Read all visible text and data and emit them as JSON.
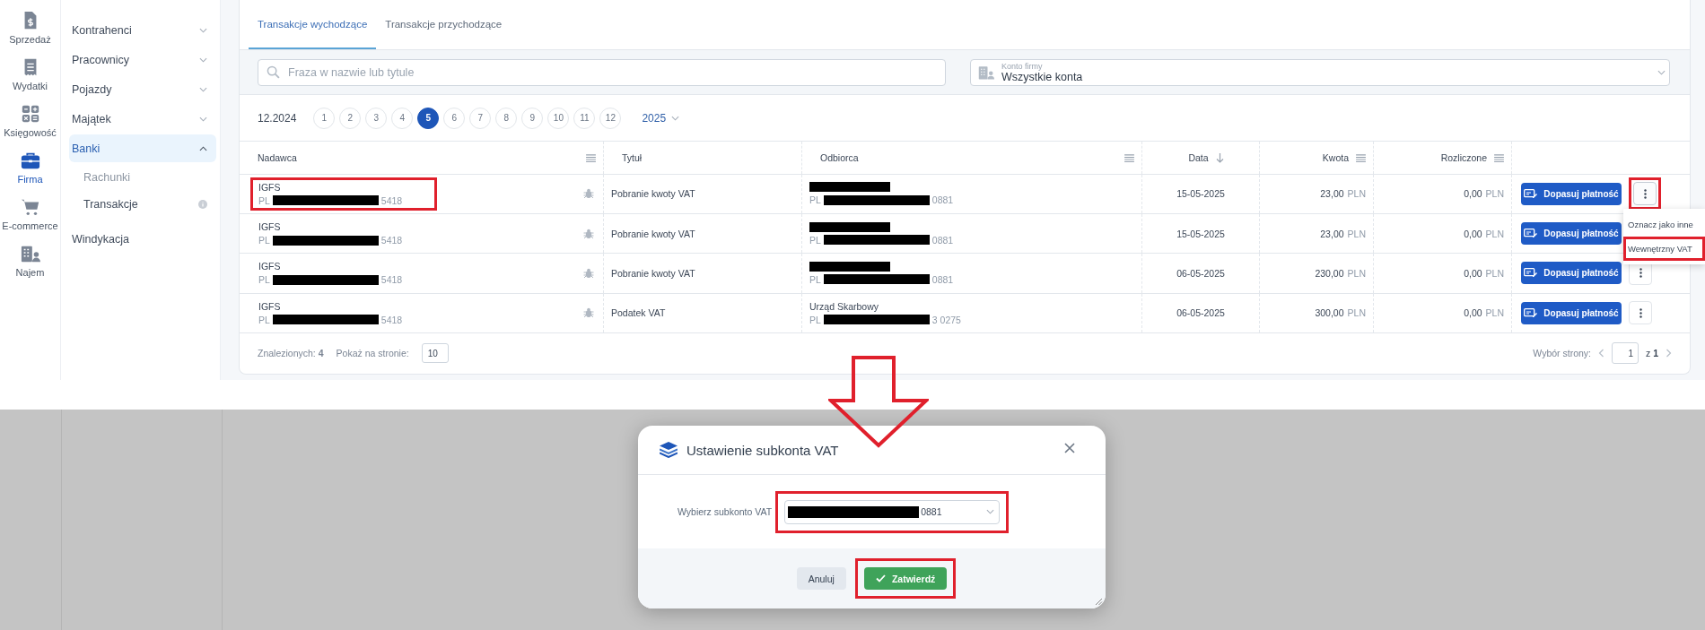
{
  "rail": [
    {
      "label": "Sprzedaż",
      "selected": false
    },
    {
      "label": "Wydatki",
      "selected": false
    },
    {
      "label": "Księgowość",
      "selected": false
    },
    {
      "label": "Firma",
      "selected": true
    },
    {
      "label": "E-commerce",
      "selected": false
    },
    {
      "label": "Najem",
      "selected": false
    }
  ],
  "nav": [
    {
      "label": "Kontrahenci",
      "expandable": true,
      "expanded": false,
      "selected": false
    },
    {
      "label": "Pracownicy",
      "expandable": true,
      "expanded": false,
      "selected": false
    },
    {
      "label": "Pojazdy",
      "expandable": true,
      "expanded": false,
      "selected": false
    },
    {
      "label": "Majątek",
      "expandable": true,
      "expanded": false,
      "selected": false
    },
    {
      "label": "Banki",
      "expandable": true,
      "expanded": true,
      "selected": true,
      "children": [
        {
          "label": "Rachunki",
          "muted": true,
          "info": false
        },
        {
          "label": "Transakcje",
          "muted": false,
          "info": true
        }
      ]
    },
    {
      "label": "Windykacja",
      "expandable": false,
      "selected": false
    }
  ],
  "tabs": [
    {
      "label": "Transakcje wychodzące",
      "selected": true
    },
    {
      "label": "Transakcje przychodzące",
      "selected": false
    }
  ],
  "search": {
    "placeholder": "Fraza w nazwie lub tytule"
  },
  "account_filter": {
    "label": "Konto firmy",
    "value": "Wszystkie konta"
  },
  "months": {
    "previous": "12.2024",
    "items": [
      {
        "label": "1",
        "selected": false
      },
      {
        "label": "2",
        "selected": false
      },
      {
        "label": "3",
        "selected": false
      },
      {
        "label": "4",
        "selected": false
      },
      {
        "label": "5",
        "selected": true
      },
      {
        "label": "6",
        "selected": false
      },
      {
        "label": "7",
        "selected": false
      },
      {
        "label": "8",
        "selected": false
      },
      {
        "label": "9",
        "selected": false
      },
      {
        "label": "10",
        "selected": false
      },
      {
        "label": "11",
        "selected": false
      },
      {
        "label": "12",
        "selected": false
      }
    ],
    "year": "2025"
  },
  "table": {
    "columns": [
      {
        "label": "Nadawca",
        "menu": true,
        "sorted": false
      },
      {
        "label": "Tytuł",
        "menu": false,
        "sorted": false
      },
      {
        "label": "Odbiorca",
        "menu": true,
        "sorted": false
      },
      {
        "label": "Data",
        "menu": false,
        "sorted": true
      },
      {
        "label": "Kwota",
        "menu": true,
        "sorted": false
      },
      {
        "label": "Rozliczone",
        "menu": true,
        "sorted": false
      }
    ],
    "rows": [
      {
        "sender": {
          "name": "IGFS",
          "prefix": "PL",
          "suffix": "5418",
          "redacted": true,
          "highlighted": true
        },
        "title": "Pobranie kwoty VAT",
        "recipient": {
          "name_redacted": true,
          "prefix": "PL",
          "suffix": "0881",
          "redacted": true
        },
        "date": "15-05-2025",
        "amount": "23,00",
        "amount_currency": "PLN",
        "settled": "0,00",
        "settled_currency": "PLN",
        "action": "Dopasuj płatność",
        "more_highlighted": true,
        "menu": {
          "items": [
            {
              "label": "Oznacz jako inne",
              "highlighted": false
            },
            {
              "label": "Wewnętrzny VAT",
              "highlighted": true
            }
          ]
        }
      },
      {
        "sender": {
          "name": "IGFS",
          "prefix": "PL",
          "suffix": "5418",
          "redacted": true,
          "highlighted": false
        },
        "title": "Pobranie kwoty VAT",
        "recipient": {
          "name_redacted": true,
          "prefix": "PL",
          "suffix": "0881",
          "redacted": true
        },
        "date": "15-05-2025",
        "amount": "23,00",
        "amount_currency": "PLN",
        "settled": "0,00",
        "settled_currency": "PLN",
        "action": "Dopasuj płatność"
      },
      {
        "sender": {
          "name": "IGFS",
          "prefix": "PL",
          "suffix": "5418",
          "redacted": true,
          "highlighted": false
        },
        "title": "Pobranie kwoty VAT",
        "recipient": {
          "name_redacted": true,
          "prefix": "PL",
          "suffix": "0881",
          "redacted": true
        },
        "date": "06-05-2025",
        "amount": "230,00",
        "amount_currency": "PLN",
        "settled": "0,00",
        "settled_currency": "PLN",
        "action": "Dopasuj płatność",
        "more_highlighted": false
      },
      {
        "sender": {
          "name": "IGFS",
          "prefix": "PL",
          "suffix": "5418",
          "redacted": true,
          "highlighted": false
        },
        "title": "Podatek VAT",
        "recipient": {
          "name": "Urząd Skarbowy",
          "prefix": "PL",
          "suffix": "3 0275",
          "redacted": true
        },
        "date": "06-05-2025",
        "amount": "300,00",
        "amount_currency": "PLN",
        "settled": "0,00",
        "settled_currency": "PLN",
        "action": "Dopasuj płatność",
        "more_highlighted": false
      }
    ]
  },
  "footer": {
    "found": "Znalezionych: **4**",
    "per_page_label": "Pokaż na stronie:",
    "per_page": "10",
    "page_label": "Wybór strony:",
    "page": "1",
    "page_total": "z **1**"
  },
  "dialog": {
    "title": "Ustawienie subkonta VAT",
    "field_label": "Wybierz subkonto VAT",
    "select": {
      "value_suffix": "0881",
      "redacted": true,
      "highlighted": true
    },
    "buttons": [
      {
        "label": "Anuluj",
        "kind": "secondary",
        "highlighted": false
      },
      {
        "label": "Zatwierdź",
        "kind": "primary",
        "highlighted": true
      }
    ]
  }
}
